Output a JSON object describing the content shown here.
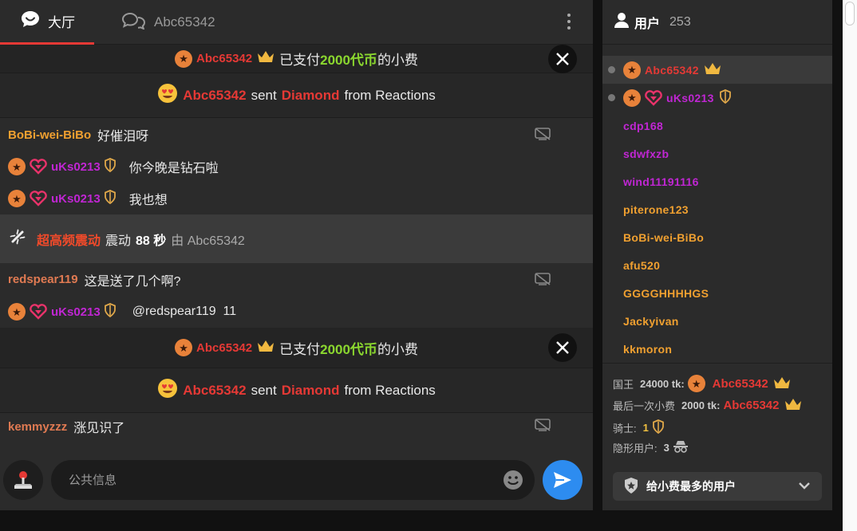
{
  "tabs": {
    "hall_label": "大厅",
    "user_tab_label": "Abc65342"
  },
  "messages": {
    "tip1": {
      "user": "Abc65342",
      "prefix": "已支付",
      "amount": "2000代币",
      "suffix": "的小费"
    },
    "reaction1": {
      "user": "Abc65342",
      "verb": "sent",
      "item": "Diamond",
      "source": "from Reactions"
    },
    "m1": {
      "user": "BoBi-wei-BiBo",
      "text": "好催泪呀"
    },
    "m2": {
      "user": "uKs0213",
      "text": "你今晚是钻石啦"
    },
    "m3": {
      "user": "uKs0213",
      "text": "我也想"
    },
    "shake": {
      "title": "超高频震动",
      "word": "震动",
      "seconds": "88 秒",
      "by": "由 Abc65342"
    },
    "m4": {
      "user": "redspear119",
      "text": "这是送了几个啊?"
    },
    "m5": {
      "user": "uKs0213",
      "text": "@redspear119  11"
    },
    "tip2": {
      "user": "Abc65342",
      "prefix": "已支付",
      "amount": "2000代币",
      "suffix": "的小费"
    },
    "reaction2": {
      "user": "Abc65342",
      "verb": "sent",
      "item": "Diamond",
      "source": "from Reactions"
    },
    "m6": {
      "user": "kemmyzzz",
      "text": "涨见识了"
    }
  },
  "composer": {
    "placeholder": "公共信息"
  },
  "users": {
    "label": "用户",
    "count": "253",
    "list": [
      {
        "name": "Abc65342"
      },
      {
        "name": "uKs0213"
      },
      {
        "name": "cdp168"
      },
      {
        "name": "sdwfxzb"
      },
      {
        "name": "wind11191116"
      },
      {
        "name": "piterone123"
      },
      {
        "name": "BoBi-wei-BiBo"
      },
      {
        "name": "afu520"
      },
      {
        "name": "GGGGHHHHGS"
      },
      {
        "name": "Jackyivan"
      },
      {
        "name": "kkmoron"
      }
    ]
  },
  "stats": {
    "king_label": "国王",
    "king_tk": "24000 tk:",
    "king_user": "Abc65342",
    "last_label": "最后一次小费",
    "last_tk": "2000 tk:",
    "last_user": "Abc65342",
    "knights_label": "骑士:",
    "knights_count": "1",
    "invisible_label": "隐形用户:",
    "invisible_count": "3",
    "top_tippers": "给小费最多的用户"
  },
  "colors": {
    "red_user": "#e53935",
    "purple_user": "#c026d3",
    "orange_user": "#f0a030",
    "accent_tab": "#e53935",
    "send_button": "#2d8cf0",
    "token_green": "#8bd72f"
  }
}
